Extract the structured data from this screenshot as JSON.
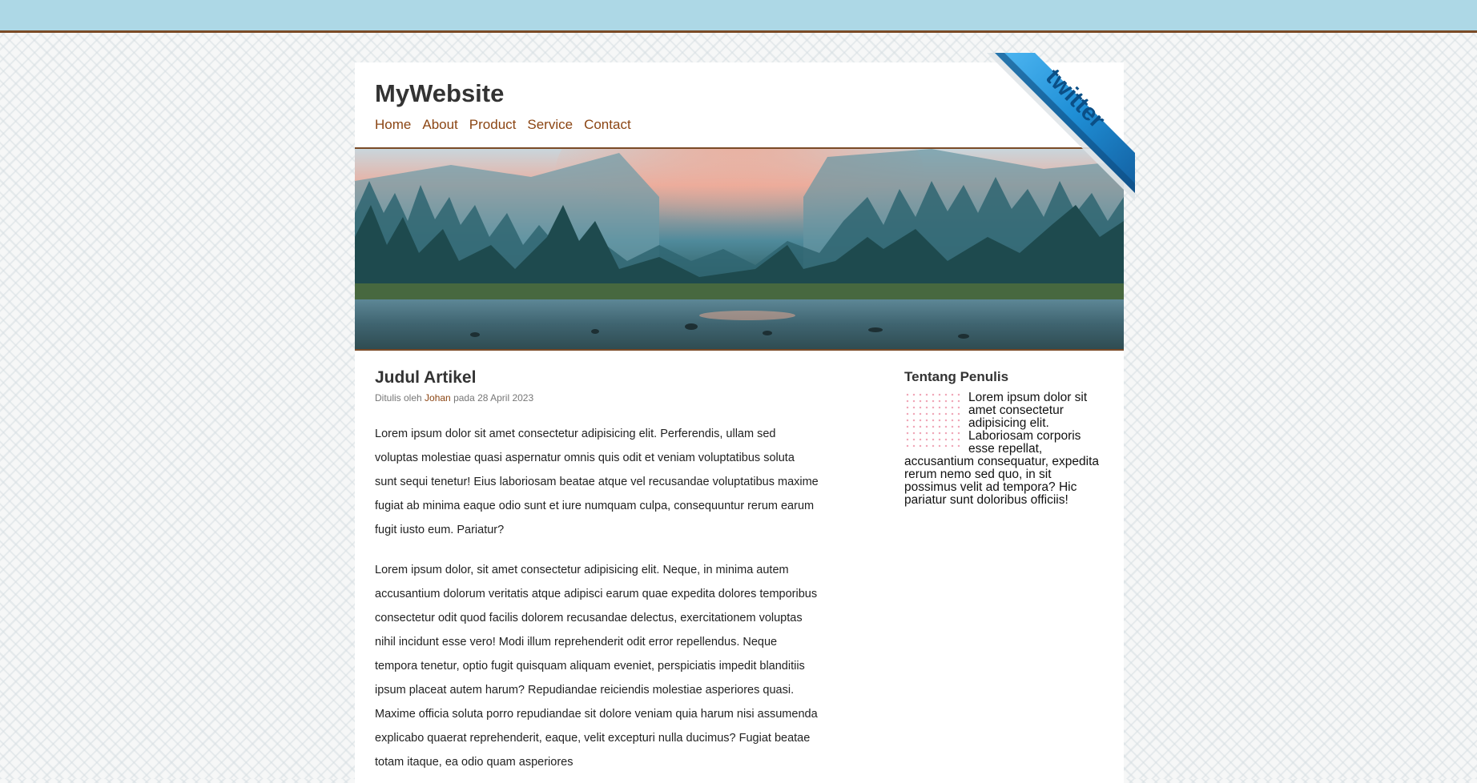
{
  "site": {
    "title": "MyWebsite"
  },
  "nav": {
    "items": [
      {
        "label": "Home"
      },
      {
        "label": "About"
      },
      {
        "label": "Product"
      },
      {
        "label": "Service"
      },
      {
        "label": "Contact"
      }
    ]
  },
  "ribbon": {
    "label": "twitter",
    "icon": "twitter-ribbon"
  },
  "article": {
    "title": "Judul Artikel",
    "meta_prefix": "Ditulis oleh ",
    "author": "Johan",
    "meta_suffix": " pada 28 April 2023",
    "paragraphs": [
      "Lorem ipsum dolor sit amet consectetur adipisicing elit. Perferendis, ullam sed voluptas molestiae quasi aspernatur omnis quis odit et veniam voluptatibus soluta sunt sequi tenetur! Eius laboriosam beatae atque vel recusandae voluptatibus maxime fugiat ab minima eaque odio sunt et iure numquam culpa, consequuntur rerum earum fugit iusto eum. Pariatur?",
      "Lorem ipsum dolor, sit amet consectetur adipisicing elit. Neque, in minima autem accusantium dolorum veritatis atque adipisci earum quae expedita dolores temporibus consectetur odit quod facilis dolorem recusandae delectus, exercitationem voluptas nihil incidunt esse vero! Modi illum reprehenderit odit error repellendus. Neque tempora tenetur, optio fugit quisquam aliquam eveniet, perspiciatis impedit blanditiis ipsum placeat autem harum? Repudiandae reiciendis molestiae asperiores quasi. Maxime officia soluta porro repudiandae sit dolore veniam quia harum nisi assumenda explicabo quaerat reprehenderit, eaque, velit excepturi nulla ducimus? Fugiat beatae totam itaque, ea odio quam asperiores"
    ]
  },
  "sidebar": {
    "title": "Tentang Penulis",
    "body": "Lorem ipsum dolor sit amet consectetur adipisicing elit. Laboriosam corporis esse repellat, accusantium consequatur, expedita rerum nemo sed quo, in sit possimus velit ad tempora? Hic pariatur sunt doloribus officiis!"
  },
  "colors": {
    "topbar": "#add8e6",
    "accent_brown": "#8b4513",
    "ribbon_blue": "#1f8fd6"
  }
}
